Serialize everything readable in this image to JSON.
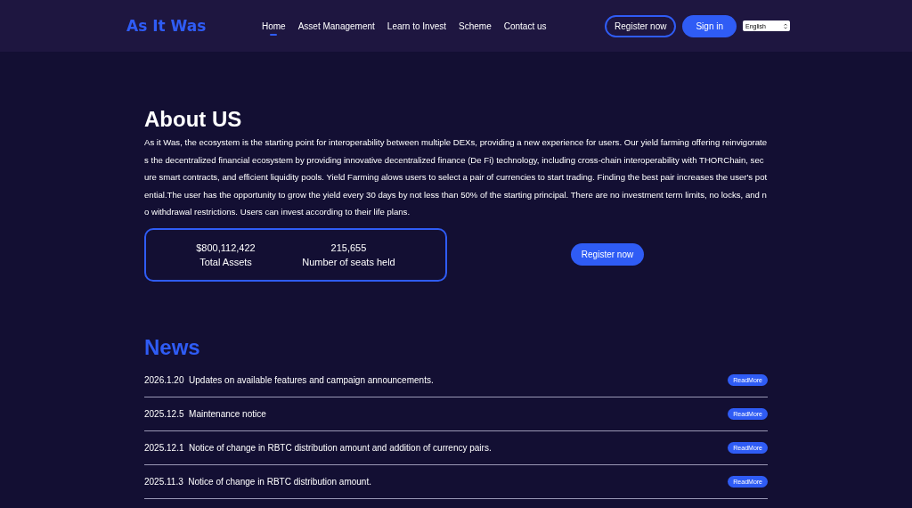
{
  "header": {
    "logo": "As It Was",
    "nav": [
      {
        "label": "Home",
        "selected": true
      },
      {
        "label": "Asset Management",
        "selected": false
      },
      {
        "label": "Learn to Invest",
        "selected": false
      },
      {
        "label": "Scheme",
        "selected": false
      },
      {
        "label": "Contact us",
        "selected": false
      }
    ],
    "register": "Register now",
    "sign_in": "Sign in",
    "language": "English"
  },
  "about": {
    "title": "About US",
    "text": "As it Was, the ecosystem is the starting point for interoperability between multiple DEXs, providing a new experience for users. Our yield farming offering reinvigorates the decentralized financial ecosystem by providing innovative decentralized finance (De Fi) technology, including cross-chain interoperability with THORChain, secure smart contracts, and efficient liquidity pools. Yield Farming alows users to select a pair of currencies to start trading. Finding the best pair increases the user's potential.The user has the opportunity to grow the yield every 30 days by not less than 50% of the starting principal. There are no investment term limits, no locks, and no withdrawal restrictions. Users can invest according to their life plans.",
    "stats": [
      {
        "value": "$800,112,422",
        "label": "Total Assets"
      },
      {
        "value": "215,655",
        "label": "Number of seats held"
      }
    ],
    "register": "Register now"
  },
  "news": {
    "title": "News",
    "items": [
      {
        "date": "2026.1.20",
        "title": "Updates on available features and campaign announcements.",
        "button": "ReadMore"
      },
      {
        "date": "2025.12.5",
        "title": "Maintenance notice",
        "button": "ReadMore"
      },
      {
        "date": "2025.12.1",
        "title": "Notice of change in RBTC distribution amount and addition of currency pairs.",
        "button": "ReadMore"
      },
      {
        "date": "2025.11.3",
        "title": "Notice of change in RBTC distribution amount.",
        "button": "ReadMore"
      }
    ]
  }
}
